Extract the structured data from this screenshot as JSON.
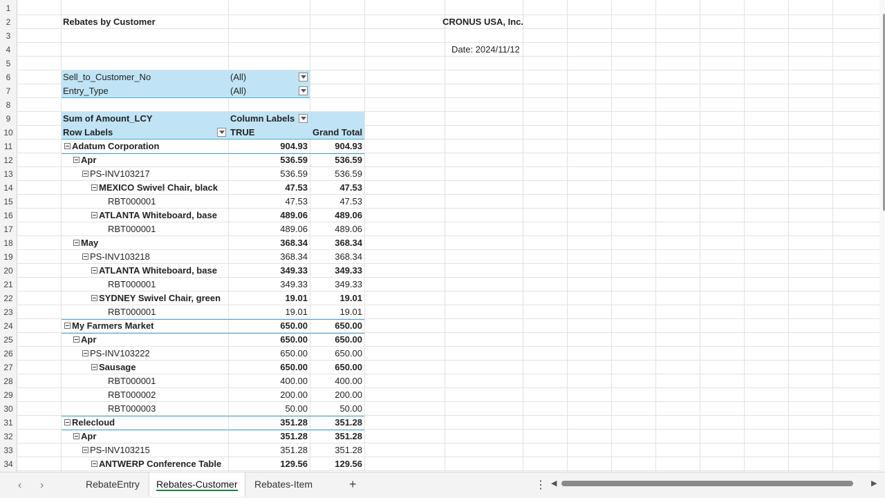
{
  "report": {
    "title": "Rebates by Customer",
    "company": "CRONUS USA, Inc.",
    "date": "Date: 2024/11/12"
  },
  "filters": [
    {
      "field": "Sell_to_Customer_No",
      "value": "(All)"
    },
    {
      "field": "Entry_Type",
      "value": "(All)"
    }
  ],
  "pivot_header": {
    "values_label": "Sum of Amount_LCY",
    "column_labels": "Column Labels",
    "row_labels": "Row Labels",
    "col_true": "TRUE",
    "col_total": "Grand Total"
  },
  "pivot_rows": [
    {
      "label": "Adatum Corporation",
      "level": 0,
      "bold": true,
      "toggle": true,
      "v1": "904.93",
      "v2": "904.93"
    },
    {
      "label": "Apr",
      "level": 1,
      "bold": true,
      "toggle": true,
      "v1": "536.59",
      "v2": "536.59"
    },
    {
      "label": "PS-INV103217",
      "level": 2,
      "bold": false,
      "toggle": true,
      "v1": "536.59",
      "v2": "536.59"
    },
    {
      "label": "MEXICO Swivel Chair, black",
      "level": 3,
      "bold": true,
      "toggle": true,
      "v1": "47.53",
      "v2": "47.53"
    },
    {
      "label": "RBT000001",
      "level": 4,
      "bold": false,
      "toggle": false,
      "v1": "47.53",
      "v2": "47.53"
    },
    {
      "label": "ATLANTA Whiteboard, base",
      "level": 3,
      "bold": true,
      "toggle": true,
      "v1": "489.06",
      "v2": "489.06"
    },
    {
      "label": "RBT000001",
      "level": 4,
      "bold": false,
      "toggle": false,
      "v1": "489.06",
      "v2": "489.06"
    },
    {
      "label": "May",
      "level": 1,
      "bold": true,
      "toggle": true,
      "v1": "368.34",
      "v2": "368.34"
    },
    {
      "label": "PS-INV103218",
      "level": 2,
      "bold": false,
      "toggle": true,
      "v1": "368.34",
      "v2": "368.34"
    },
    {
      "label": "ATLANTA Whiteboard, base",
      "level": 3,
      "bold": true,
      "toggle": true,
      "v1": "349.33",
      "v2": "349.33"
    },
    {
      "label": "RBT000001",
      "level": 4,
      "bold": false,
      "toggle": false,
      "v1": "349.33",
      "v2": "349.33"
    },
    {
      "label": "SYDNEY Swivel Chair, green",
      "level": 3,
      "bold": true,
      "toggle": true,
      "v1": "19.01",
      "v2": "19.01"
    },
    {
      "label": "RBT000001",
      "level": 4,
      "bold": false,
      "toggle": false,
      "v1": "19.01",
      "v2": "19.01"
    },
    {
      "label": "My Farmers Market",
      "level": 0,
      "bold": true,
      "toggle": true,
      "v1": "650.00",
      "v2": "650.00"
    },
    {
      "label": "Apr",
      "level": 1,
      "bold": true,
      "toggle": true,
      "v1": "650.00",
      "v2": "650.00"
    },
    {
      "label": "PS-INV103222",
      "level": 2,
      "bold": false,
      "toggle": true,
      "v1": "650.00",
      "v2": "650.00"
    },
    {
      "label": "Sausage",
      "level": 3,
      "bold": true,
      "toggle": true,
      "v1": "650.00",
      "v2": "650.00"
    },
    {
      "label": "RBT000001",
      "level": 4,
      "bold": false,
      "toggle": false,
      "v1": "400.00",
      "v2": "400.00"
    },
    {
      "label": "RBT000002",
      "level": 4,
      "bold": false,
      "toggle": false,
      "v1": "200.00",
      "v2": "200.00"
    },
    {
      "label": "RBT000003",
      "level": 4,
      "bold": false,
      "toggle": false,
      "v1": "50.00",
      "v2": "50.00"
    },
    {
      "label": "Relecloud",
      "level": 0,
      "bold": true,
      "toggle": true,
      "v1": "351.28",
      "v2": "351.28"
    },
    {
      "label": "Apr",
      "level": 1,
      "bold": true,
      "toggle": true,
      "v1": "351.28",
      "v2": "351.28"
    },
    {
      "label": "PS-INV103215",
      "level": 2,
      "bold": false,
      "toggle": true,
      "v1": "351.28",
      "v2": "351.28"
    },
    {
      "label": "ANTWERP Conference Table",
      "level": 3,
      "bold": true,
      "toggle": true,
      "v1": "129.56",
      "v2": "129.56"
    }
  ],
  "row_numbers": [
    "1",
    "2",
    "3",
    "4",
    "5",
    "6",
    "7",
    "8",
    "9",
    "10",
    "11",
    "12",
    "13",
    "14",
    "15",
    "16",
    "17",
    "18",
    "19",
    "20",
    "21",
    "22",
    "23",
    "24",
    "25",
    "26",
    "27",
    "28",
    "29",
    "30",
    "31",
    "32",
    "33",
    "34"
  ],
  "tabs": [
    {
      "label": "RebateEntry",
      "active": false
    },
    {
      "label": "Rebates-Customer",
      "active": true
    },
    {
      "label": "Rebates-Item",
      "active": false
    }
  ],
  "tabbar": {
    "prev_icon": "‹",
    "next_icon": "›",
    "add_icon": "+",
    "more_icon": "⋮",
    "scroll_left_icon": "◀",
    "scroll_right_icon": "▶"
  },
  "colors": {
    "header_band": "#c0e4f5",
    "separator": "#4aa6cf",
    "active_tab_underline": "#1e7a45"
  }
}
